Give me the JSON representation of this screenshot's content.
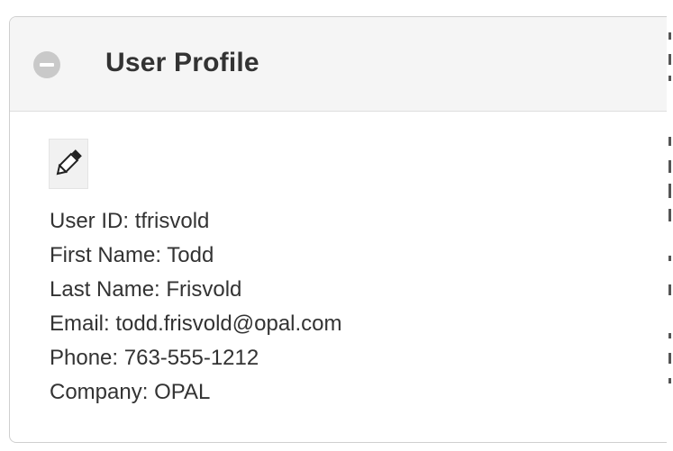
{
  "panel": {
    "title": "User Profile",
    "collapse_icon": "minus-circle-icon",
    "edit_icon": "pencil-icon"
  },
  "profile": {
    "fields": [
      {
        "label": "User ID:",
        "value": "tfrisvold"
      },
      {
        "label": "First Name:",
        "value": "Todd"
      },
      {
        "label": "Last Name:",
        "value": "Frisvold"
      },
      {
        "label": "Email:",
        "value": "todd.frisvold@opal.com"
      },
      {
        "label": "Phone:",
        "value": "763-555-1212"
      },
      {
        "label": "Company:",
        "value": "OPAL"
      }
    ]
  },
  "colors": {
    "header_bg": "#f5f5f5",
    "text": "#333333",
    "collapse_icon": "#c9c9c9",
    "border": "#cfcfcf"
  }
}
